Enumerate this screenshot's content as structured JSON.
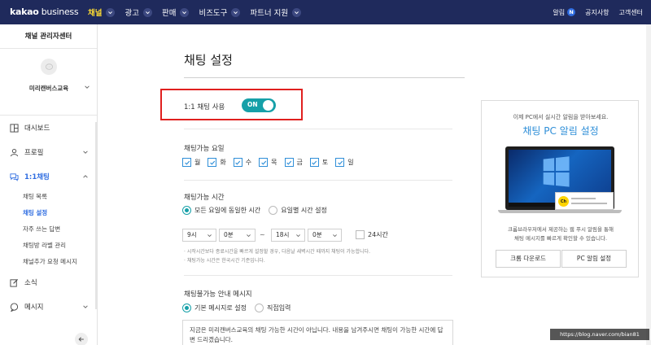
{
  "topbar": {
    "brand_main": "kakao",
    "brand_sub": " business",
    "nav": [
      {
        "label": "채널",
        "active": true
      },
      {
        "label": "광고",
        "active": false
      },
      {
        "label": "판매",
        "active": false
      },
      {
        "label": "비즈도구",
        "active": false
      },
      {
        "label": "파트너 지원",
        "active": false
      }
    ],
    "alarm_label": "알림",
    "alarm_badge": "N",
    "notice_label": "공지사항",
    "support_label": "고객센터"
  },
  "sidebar": {
    "title": "채널 관리자센터",
    "profile_name": "미리캔버스교육",
    "menu": {
      "dashboard": "대시보드",
      "profile": "프로필",
      "chat": "1:1채팅",
      "chat_sub": [
        "채팅 목록",
        "채팅 설정",
        "자주 쓰는 답변",
        "채팅방 라벨 관리",
        "채널추가 요청 메시지"
      ],
      "news": "소식",
      "message": "메시지"
    }
  },
  "main": {
    "title": "채팅 설정",
    "chat_use_label": "1:1 채팅 사용",
    "toggle_text": "ON",
    "days_label": "채팅가능 요일",
    "days": [
      "월",
      "화",
      "수",
      "목",
      "금",
      "토",
      "일"
    ],
    "time_label": "채팅가능 시간",
    "time_option_same": "모든 요일에 동일한 시간",
    "time_option_each": "요일별 시간 설정",
    "start_hour": "9시",
    "start_min": "0분",
    "dash": "~",
    "end_hour": "18시",
    "end_min": "0분",
    "all_day": "24시간",
    "note_1": "· 시작시간보다 종료시간을 빠르게 설정할 경우, 다음날 새벽시간 때까지 채팅이 가능합니다.",
    "note_2": "· 채팅가능 시간은 한국시간 기준입니다.",
    "unavailable_label": "채팅불가능 안내 메시지",
    "msg_option_default": "기본 메시지로 설정",
    "msg_option_custom": "직접입력",
    "default_message": "지금은 미리캔버스교육의 채팅 가능한 시간이 아닙니다. 내용을 남겨주시면 채팅이 가능한 시간에 답변 드리겠습니다."
  },
  "promo": {
    "subtitle": "이제 PC에서 실시간 알림을 받아보세요.",
    "title": "채팅 PC 알림 설정",
    "notif_icon": "Ch",
    "desc_1": "크롬브라우저에서 제공하는 웹 푸시 알림을 통해",
    "desc_2": "채팅 메시지를 빠르게 확인할 수 있습니다.",
    "btn_download": "크롬 다운로드",
    "btn_setting": "PC 알림 설정"
  },
  "watermark": "https://blog.naver.com/bian81",
  "colors": {
    "topbar": "#1f2a5c",
    "active_nav": "#ffdd33",
    "accent_blue": "#2f6de1",
    "toggle": "#16a0a8",
    "highlight": "#e0201f"
  }
}
